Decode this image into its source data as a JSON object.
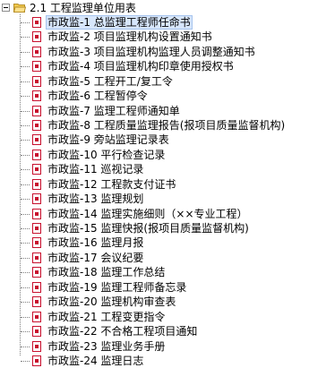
{
  "tree": {
    "root": {
      "label": "2.1 工程监理单位用表",
      "expanded": true,
      "icon": "open-folder-icon"
    },
    "selected_index": 0,
    "item_icon": "document-icon",
    "items": [
      {
        "label": "市政监-1 总监理工程师任命书"
      },
      {
        "label": "市政监-2 项目监理机构设置通知书"
      },
      {
        "label": "市政监-3 项目监理机构监理人员调整通知书"
      },
      {
        "label": "市政监-4 项目监理机构印章使用授权书"
      },
      {
        "label": "市政监-5 工程开工/复工令"
      },
      {
        "label": "市政监-6 工程暂停令"
      },
      {
        "label": "市政监-7 监理工程师通知单"
      },
      {
        "label": "市政监-8 工程质量监理报告(报项目质量监督机构)"
      },
      {
        "label": "市政监-9 旁站监理记录表"
      },
      {
        "label": "市政监-10 平行检查记录"
      },
      {
        "label": "市政监-11 巡视记录"
      },
      {
        "label": "市政监-12 工程款支付证书"
      },
      {
        "label": "市政监-13 监理规划"
      },
      {
        "label": "市政监-14 监理实施细则（××专业工程）"
      },
      {
        "label": "市政监-15 监理快报(报项目质量监督机构)"
      },
      {
        "label": "市政监-16 监理月报"
      },
      {
        "label": "市政监-17 会议纪要"
      },
      {
        "label": "市政监-18 监理工作总结"
      },
      {
        "label": "市政监-19 监理工程师备忘录"
      },
      {
        "label": "市政监-20 监理机构审查表"
      },
      {
        "label": "市政监-21 工程变更指令"
      },
      {
        "label": "市政监-22 不合格工程项目通知"
      },
      {
        "label": "市政监-23 监理业务手册"
      },
      {
        "label": "市政监-24 监理日志"
      }
    ]
  },
  "colors": {
    "selection_bg": "#d7e6fb",
    "icon_red": "#c8102e",
    "folder_yellow": "#f2c94c"
  }
}
